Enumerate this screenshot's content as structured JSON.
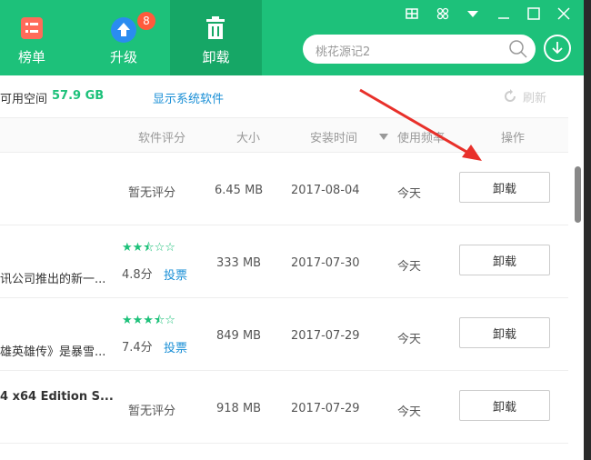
{
  "nav": {
    "tabs": [
      {
        "label": "榜单",
        "icon": "ranking-list-icon"
      },
      {
        "label": "升级",
        "icon": "upgrade-arrow-icon",
        "badge": "8"
      },
      {
        "label": "卸载",
        "icon": "trash-icon"
      }
    ]
  },
  "window": {
    "controls": [
      "skin-icon",
      "settings-icon",
      "menu-dropdown-icon",
      "minimize-icon",
      "maximize-icon",
      "close-icon"
    ]
  },
  "search": {
    "value": "桃花源记2"
  },
  "info": {
    "space_label": "可用空间",
    "space_value": "57.9 GB",
    "system_software_link": "显示系统软件",
    "refresh_label": "刷新"
  },
  "columns": {
    "rating": "软件评分",
    "size": "大小",
    "install_time": "安装时间",
    "usage": "使用频率",
    "action": "操作"
  },
  "rows": [
    {
      "name": "",
      "rating_text": "暂无评分",
      "score": "",
      "vote": "",
      "size": "6.45 MB",
      "date": "2017-08-04",
      "usage": "今天",
      "action": "卸载"
    },
    {
      "name": "讯公司推出的新一...",
      "rating_text": "",
      "stars": "★★⯪☆☆",
      "score": "4.8分",
      "vote": "投票",
      "size": "333 MB",
      "date": "2017-07-30",
      "usage": "今天",
      "action": "卸载"
    },
    {
      "name": "雄英雄传》是暴雪...",
      "rating_text": "",
      "stars": "★★★⯪☆",
      "score": "7.4分",
      "vote": "投票",
      "size": "849 MB",
      "date": "2017-07-29",
      "usage": "今天",
      "action": "卸载"
    },
    {
      "name": "4 x64 Edition S...",
      "rating_text": "暂无评分",
      "score": "",
      "vote": "",
      "size": "918 MB",
      "date": "2017-07-29",
      "usage": "今天",
      "action": "卸载"
    }
  ],
  "colors": {
    "brand": "#1dc17a",
    "active_tab": "#16a766",
    "link": "#1a8fd6"
  }
}
